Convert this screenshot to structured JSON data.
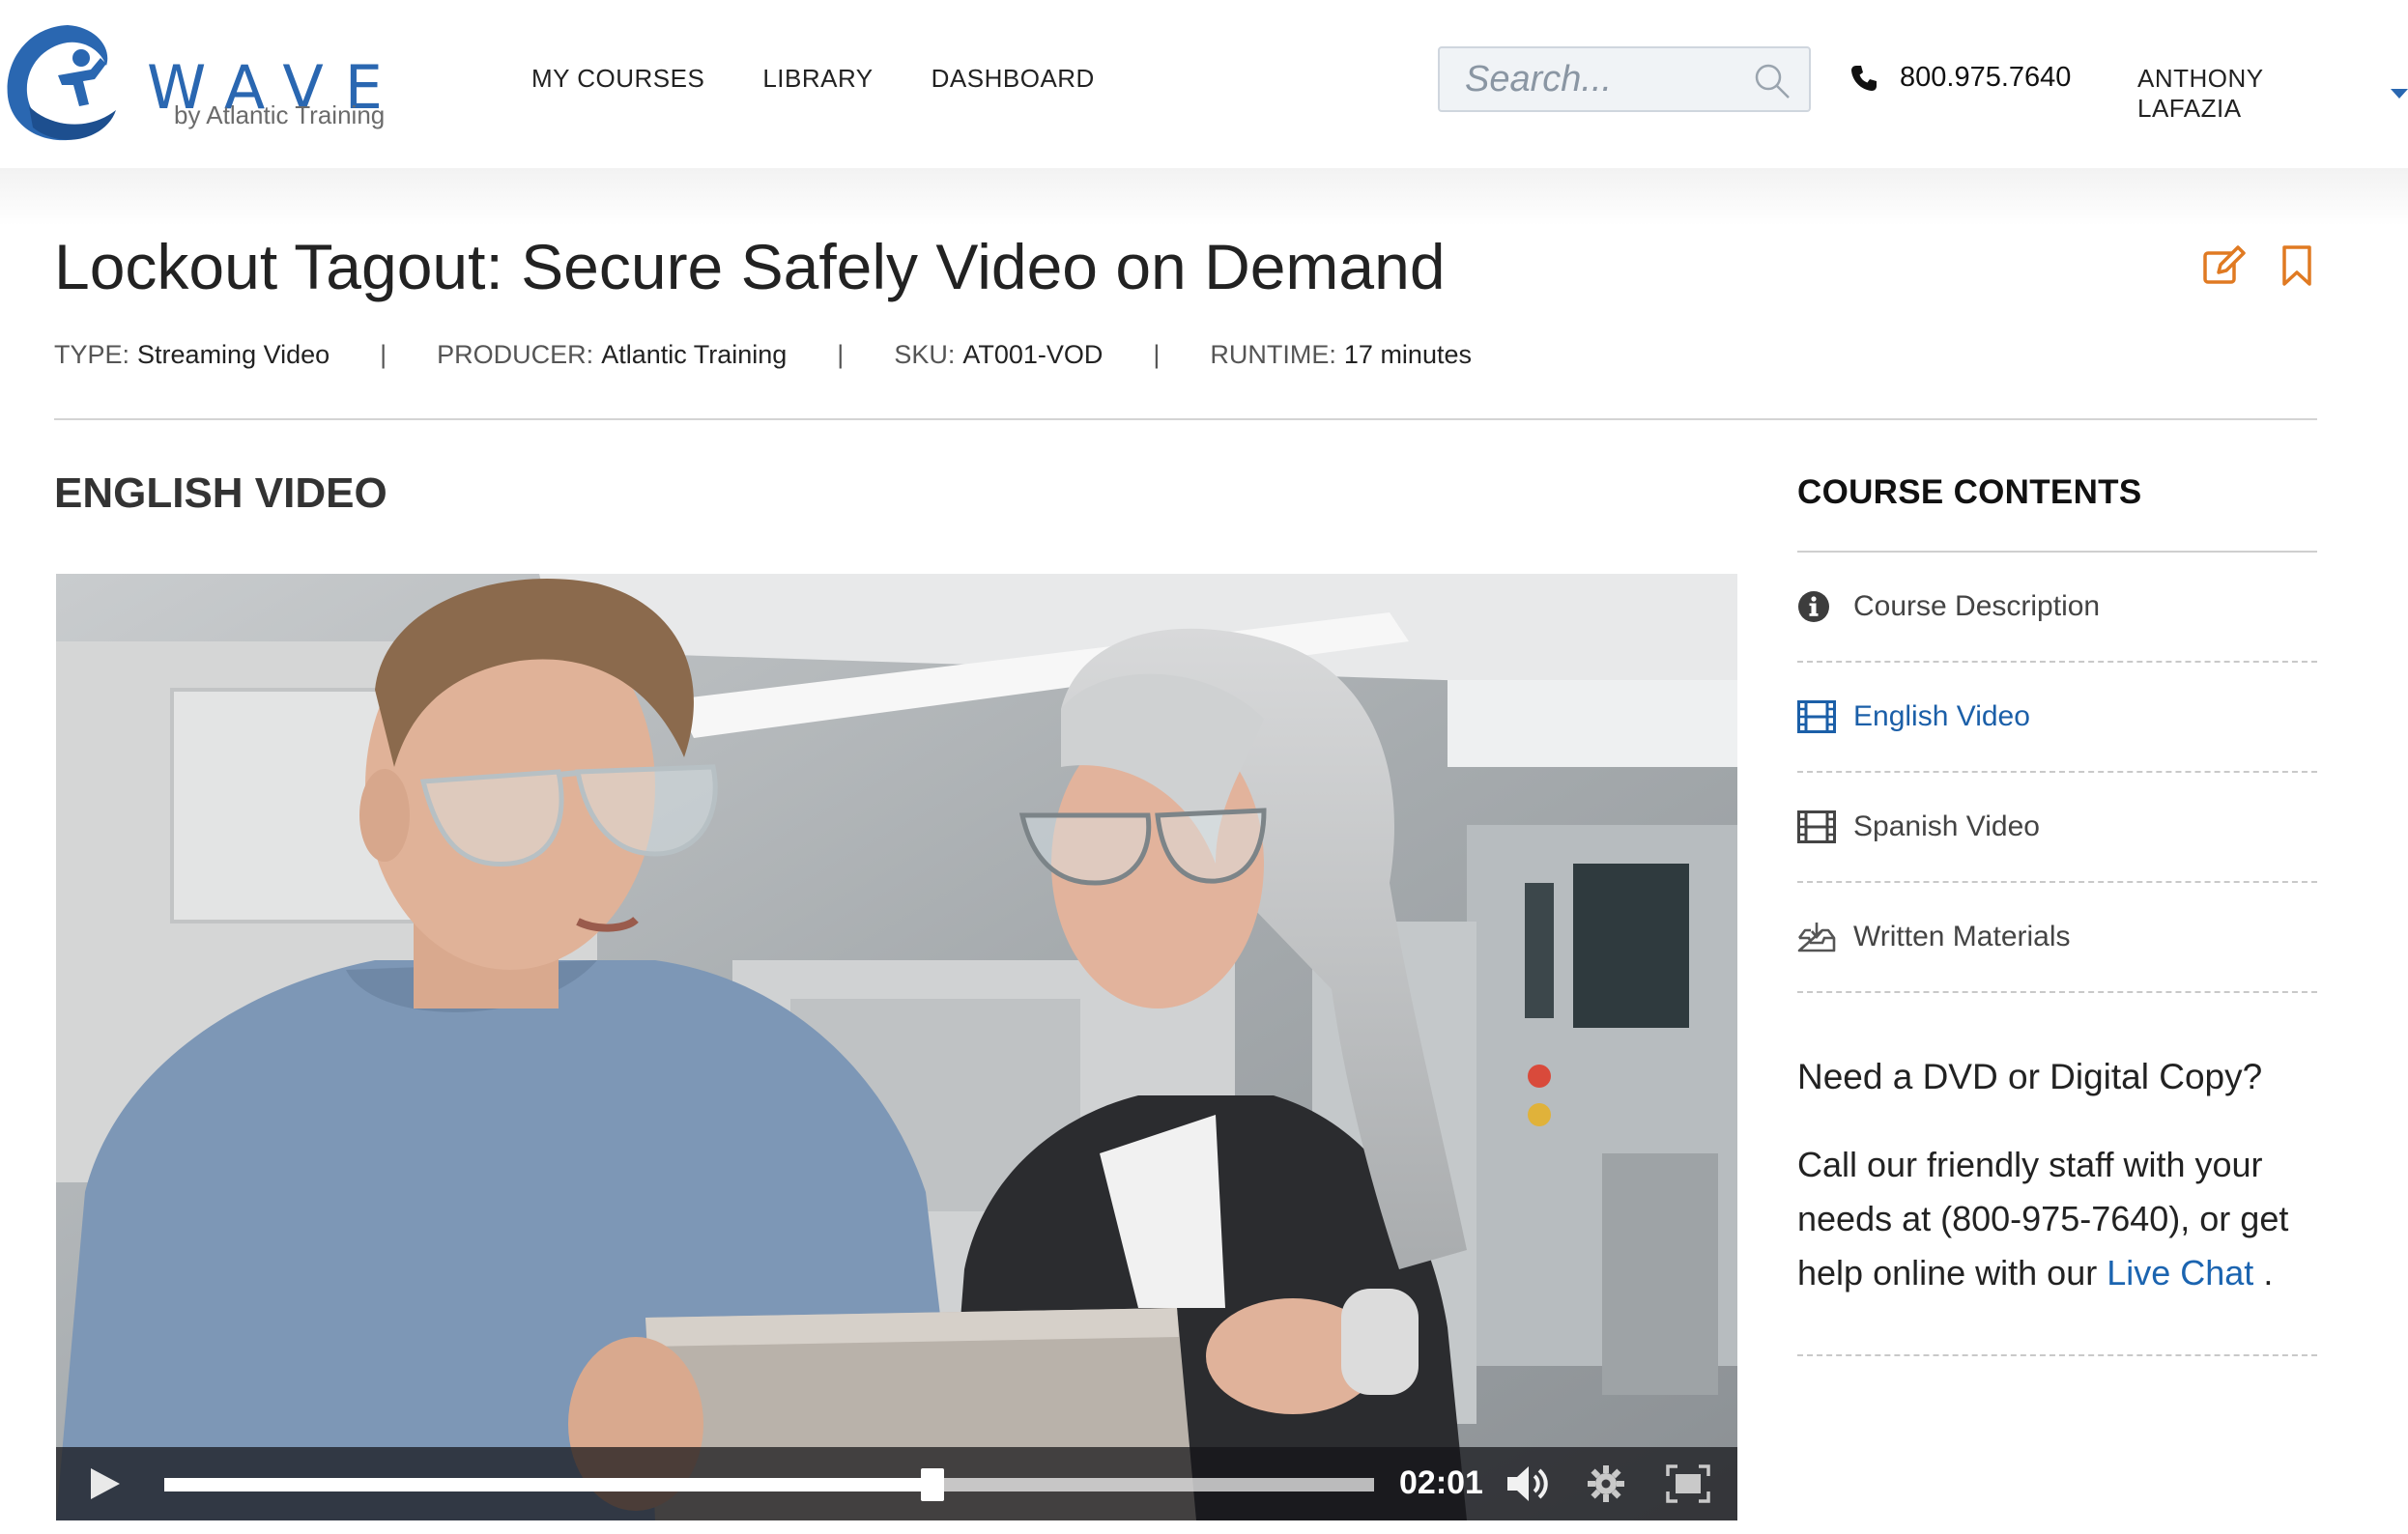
{
  "logo": {
    "word": "WAVE",
    "sub": "by Atlantic Training",
    "brand_color": "#2a67b1"
  },
  "nav": {
    "items": [
      "MY COURSES",
      "LIBRARY",
      "DASHBOARD"
    ]
  },
  "search": {
    "placeholder": "Search...",
    "value": "",
    "icon": "search-icon"
  },
  "phone": {
    "number": "800.975.7640",
    "icon": "phone-icon"
  },
  "user": {
    "name": "ANTHONY LAFAZIA",
    "icon": "chevron-down-icon"
  },
  "course": {
    "title": "Lockout Tagout: Secure Safely Video on Demand",
    "meta": {
      "type_label": "TYPE:",
      "type_value": "Streaming Video",
      "producer_label": "PRODUCER:",
      "producer_value": "Atlantic Training",
      "sku_label": "SKU:",
      "sku_value": "AT001-VOD",
      "runtime_label": "RUNTIME:",
      "runtime_value": "17 minutes",
      "separator": "|"
    },
    "actions": {
      "edit_icon": "edit-note-icon",
      "bookmark_icon": "bookmark-icon",
      "accent": "#e07a22"
    }
  },
  "section": {
    "title": "ENGLISH VIDEO"
  },
  "player": {
    "time": "02:01",
    "progress_fraction": 0.635,
    "buffered_fraction": 1.0,
    "icons": [
      "play-icon",
      "volume-icon",
      "gear-icon",
      "fullscreen-icon"
    ]
  },
  "sidebar": {
    "title": "COURSE CONTENTS",
    "items": [
      {
        "label": "Course Description",
        "icon": "info-icon",
        "active": false
      },
      {
        "label": "English Video",
        "icon": "film-icon",
        "active": true
      },
      {
        "label": "Spanish Video",
        "icon": "film-icon",
        "active": false
      },
      {
        "label": "Written Materials",
        "icon": "download-tray-icon",
        "active": false
      }
    ],
    "dvd": {
      "title": "Need a DVD or Digital Copy?",
      "text": "Call our friendly staff with your needs at (800-975-7640), or get help online with our",
      "link": "Live Chat",
      "tail": " ."
    },
    "active_color": "#1b5fa8"
  }
}
